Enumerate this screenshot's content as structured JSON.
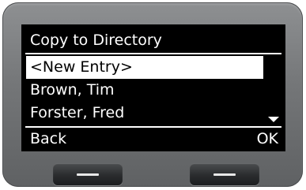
{
  "screen": {
    "title": "Copy to Directory",
    "list": {
      "items": [
        {
          "label": "<New Entry>",
          "selected": true
        },
        {
          "label": "Brown, Tim",
          "selected": false
        },
        {
          "label": "Forster, Fred",
          "selected": false
        }
      ],
      "more_below_icon": "scroll-down-arrow"
    },
    "softkeys": {
      "left_label": "Back",
      "right_label": "OK"
    }
  },
  "hardware_keys": {
    "left_icon": "minus-bar",
    "right_icon": "minus-bar"
  },
  "colors": {
    "display_background": "#000000",
    "display_text": "#ffffff",
    "selection_background": "#ffffff",
    "selection_text": "#000000",
    "device_bezel": "#747678"
  }
}
